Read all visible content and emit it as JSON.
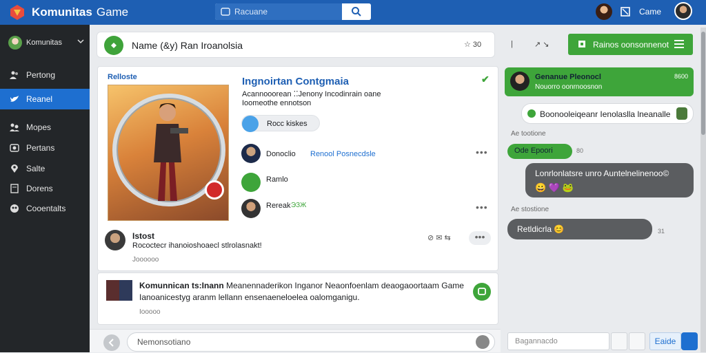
{
  "app": {
    "title": "Komunitas",
    "subtitle": "Game"
  },
  "search": {
    "placeholder": "Racuane"
  },
  "topbar": {
    "label": "Came"
  },
  "sidebar": {
    "user": "Komunitas",
    "items": [
      {
        "label": "Pertong",
        "icon": "people-icon"
      },
      {
        "label": "Reanel",
        "icon": "bird-icon",
        "active": true
      },
      {
        "label": "Mopes",
        "icon": "group-icon"
      },
      {
        "label": "Pertans",
        "icon": "photo-icon"
      },
      {
        "label": "Salte",
        "icon": "location-icon"
      },
      {
        "label": "Dorens",
        "icon": "document-icon"
      },
      {
        "label": "Cooentalts",
        "icon": "friends-icon"
      }
    ]
  },
  "header": {
    "title": "Name (&y) Ran Iroanolsia",
    "icon1": "☆ 30",
    "icon2": "|",
    "icon3": "↗ ↘"
  },
  "action_button": {
    "label": "Rainos oonsonnenot"
  },
  "post": {
    "tag": "Relloste",
    "title": "Ingnoirtan Contgmaia",
    "subtitle_1": "Acannooorean ⁚⁚Jenony Incodinrain oane",
    "subtitle_2": "Ioomeothe ennotson",
    "pill": "Rocc kiskes",
    "members": [
      {
        "name": "Donoclio",
        "status": "Renool Posnecdsle"
      },
      {
        "name": "Ramlo",
        "status": ""
      },
      {
        "name": "Rereak",
        "status": "ЭЗЖ"
      }
    ]
  },
  "comment": {
    "name": "Istost",
    "text": "Rococtecr ihanoioshoaecl stlrolasnakt!",
    "time": "Joooooo",
    "icons": "⊘ ✉ ⇆"
  },
  "post2": {
    "author": "Komunnican ts:Inann",
    "text": "Meanennaderikon Inganor Neaonfoenlam deaogaoortaam Game Ianoanicestyg aranm lellann ensenaeneloelea oalomganigu.",
    "time": "Iooooo"
  },
  "composer": {
    "placeholder": "Nemonsotiano"
  },
  "chat": {
    "head": {
      "name": "Genanue Pleonocl",
      "status": "Nouorro oonrnoosnon",
      "time": "8600"
    },
    "bubble1": "Boonooleiqeanr Ienolaslla lneanalle",
    "label1": "Ae tootione",
    "bubble2": "Ode Epoori",
    "bubble2_time": "80",
    "bubble3": "Lonrlonlatsre unro Auntelnelinenoo©",
    "bubble3_emoji": "😀 💜 🐸",
    "label2": "Ae stostione",
    "bubble4": "Retldicrla 😊",
    "bubble4_time": "31",
    "input_placeholder": "Bagannacdo",
    "send_label": "Eaide"
  }
}
